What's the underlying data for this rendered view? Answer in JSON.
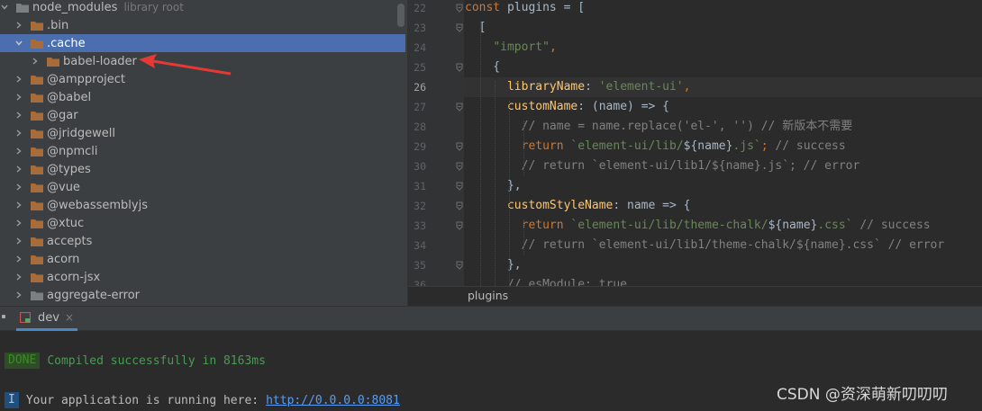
{
  "project_tree": {
    "root": {
      "label": "node_modules",
      "hint": "library root"
    },
    "items": [
      {
        "label": ".bin",
        "expanded": false,
        "selected": false,
        "folder_color": "#a86b3a"
      },
      {
        "label": ".cache",
        "expanded": true,
        "selected": true,
        "folder_color": "#a86b3a"
      },
      {
        "label": "babel-loader",
        "expanded": false,
        "selected": false,
        "folder_color": "#a86b3a"
      },
      {
        "label": "@ampproject",
        "expanded": false,
        "selected": false,
        "folder_color": "#a86b3a"
      },
      {
        "label": "@babel",
        "expanded": false,
        "selected": false,
        "folder_color": "#a86b3a"
      },
      {
        "label": "@gar",
        "expanded": false,
        "selected": false,
        "folder_color": "#a86b3a"
      },
      {
        "label": "@jridgewell",
        "expanded": false,
        "selected": false,
        "folder_color": "#a86b3a"
      },
      {
        "label": "@npmcli",
        "expanded": false,
        "selected": false,
        "folder_color": "#a86b3a"
      },
      {
        "label": "@types",
        "expanded": false,
        "selected": false,
        "folder_color": "#a86b3a"
      },
      {
        "label": "@vue",
        "expanded": false,
        "selected": false,
        "folder_color": "#a86b3a"
      },
      {
        "label": "@webassemblyjs",
        "expanded": false,
        "selected": false,
        "folder_color": "#a86b3a"
      },
      {
        "label": "@xtuc",
        "expanded": false,
        "selected": false,
        "folder_color": "#a86b3a"
      },
      {
        "label": "accepts",
        "expanded": false,
        "selected": false,
        "folder_color": "#a86b3a"
      },
      {
        "label": "acorn",
        "expanded": false,
        "selected": false,
        "folder_color": "#a86b3a"
      },
      {
        "label": "acorn-jsx",
        "expanded": false,
        "selected": false,
        "folder_color": "#a86b3a"
      },
      {
        "label": "aggregate-error",
        "expanded": false,
        "selected": false,
        "folder_color": "#7c7f82"
      }
    ]
  },
  "editor": {
    "current_line": "26",
    "lines": [
      {
        "number": "22",
        "tokens": [
          {
            "t": "const ",
            "c": "kw"
          },
          {
            "t": "plugins = [",
            "c": "plain"
          }
        ]
      },
      {
        "number": "23",
        "tokens": [
          {
            "t": "  [",
            "c": "plain"
          }
        ]
      },
      {
        "number": "24",
        "tokens": [
          {
            "t": "    ",
            "c": "plain"
          },
          {
            "t": "\"import\"",
            "c": "str"
          },
          {
            "t": ",",
            "c": "kw"
          }
        ]
      },
      {
        "number": "25",
        "tokens": [
          {
            "t": "    {",
            "c": "plain"
          }
        ]
      },
      {
        "number": "26",
        "tokens": [
          {
            "t": "      ",
            "c": "plain"
          },
          {
            "t": "libraryName",
            "c": "prop"
          },
          {
            "t": ": ",
            "c": "plain"
          },
          {
            "t": "'element-ui'",
            "c": "str"
          },
          {
            "t": ",",
            "c": "kw"
          }
        ]
      },
      {
        "number": "27",
        "tokens": [
          {
            "t": "      ",
            "c": "plain"
          },
          {
            "t": "customName",
            "c": "prop"
          },
          {
            "t": ": (name) => {",
            "c": "plain"
          }
        ]
      },
      {
        "number": "28",
        "tokens": [
          {
            "t": "        // name = name.replace('el-', '') // 新版本不需要",
            "c": "comment"
          }
        ]
      },
      {
        "number": "29",
        "tokens": [
          {
            "t": "        ",
            "c": "plain"
          },
          {
            "t": "return ",
            "c": "kw"
          },
          {
            "t": "`element-ui/lib/",
            "c": "str"
          },
          {
            "t": "${name}",
            "c": "plain"
          },
          {
            "t": ".js`",
            "c": "str"
          },
          {
            "t": "; ",
            "c": "kw"
          },
          {
            "t": "// success",
            "c": "comment"
          }
        ]
      },
      {
        "number": "30",
        "tokens": [
          {
            "t": "        // return `element-ui/lib1/${name}.js`; // error",
            "c": "comment"
          }
        ]
      },
      {
        "number": "31",
        "tokens": [
          {
            "t": "      },",
            "c": "plain"
          }
        ]
      },
      {
        "number": "32",
        "tokens": [
          {
            "t": "      ",
            "c": "plain"
          },
          {
            "t": "customStyleName",
            "c": "prop"
          },
          {
            "t": ": name => {",
            "c": "plain"
          }
        ]
      },
      {
        "number": "33",
        "tokens": [
          {
            "t": "        ",
            "c": "plain"
          },
          {
            "t": "return ",
            "c": "kw"
          },
          {
            "t": "`element-ui/lib/theme-chalk/",
            "c": "str"
          },
          {
            "t": "${name}",
            "c": "plain"
          },
          {
            "t": ".css`",
            "c": "str"
          },
          {
            "t": " // success",
            "c": "comment"
          }
        ]
      },
      {
        "number": "34",
        "tokens": [
          {
            "t": "        // return `element-ui/lib1/theme-chalk/${name}.css` // error",
            "c": "comment"
          }
        ]
      },
      {
        "number": "35",
        "tokens": [
          {
            "t": "      },",
            "c": "plain"
          }
        ]
      },
      {
        "number": "36",
        "tokens": [
          {
            "t": "      // esModule: true",
            "c": "comment"
          }
        ]
      }
    ],
    "breadcrumb": "plugins"
  },
  "run_panel": {
    "tab_label": "dev",
    "tab_close": "×",
    "done_badge": "DONE",
    "compiled_message": "Compiled successfully in 8163ms",
    "info_badge": "I",
    "running_message": "Your application is running here:",
    "url": "http://0.0.0.0:8081"
  },
  "watermark": "CSDN @资深萌新叨叨叨",
  "colors": {
    "tree_background": "#3c3f41",
    "selection": "#4b6eaf",
    "editor_background": "#2b2b2b",
    "annotation_arrow": "#e53935"
  }
}
